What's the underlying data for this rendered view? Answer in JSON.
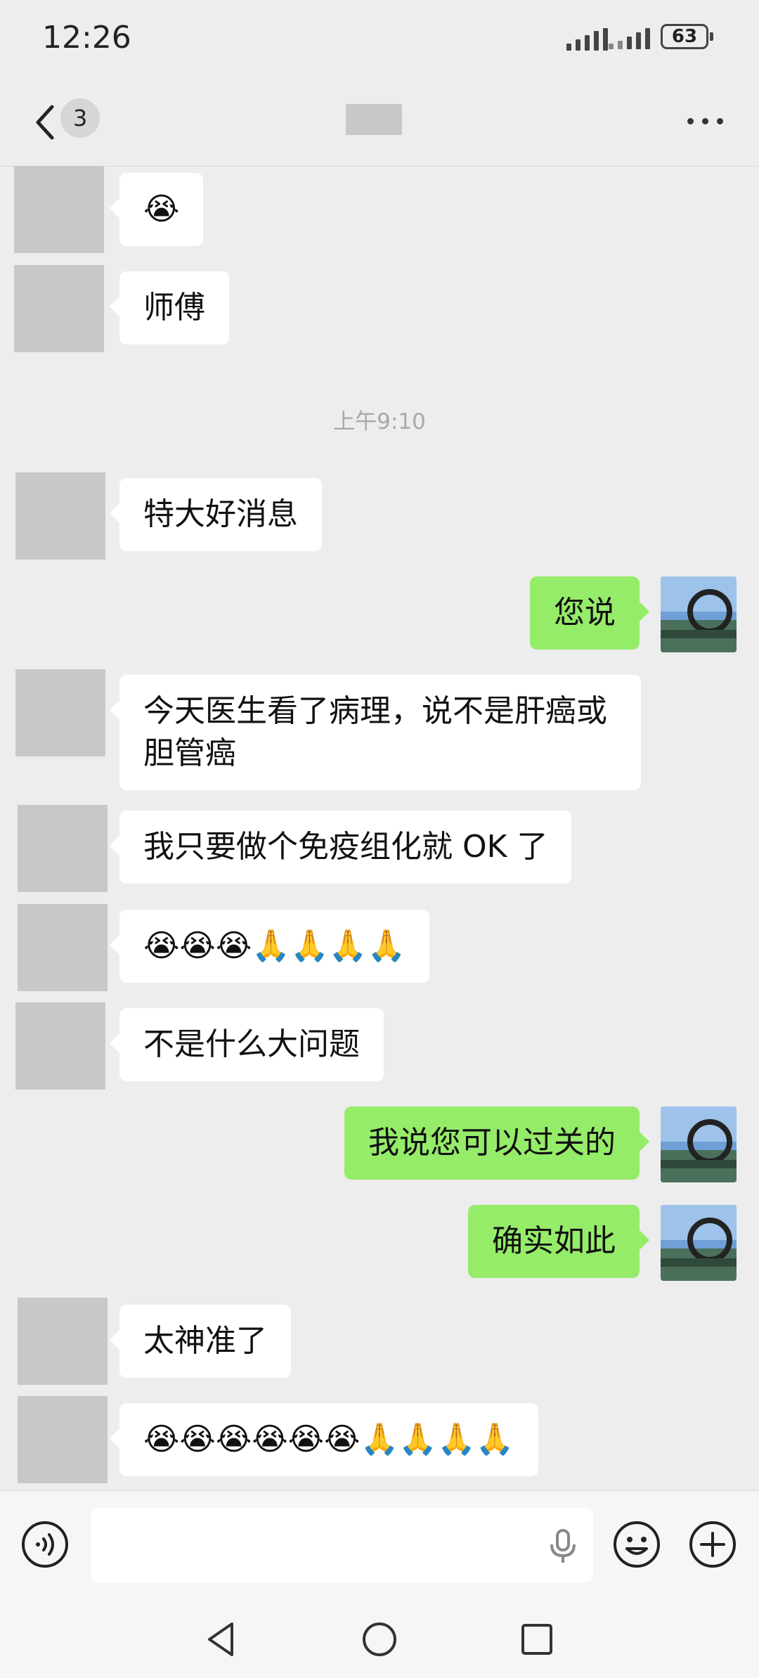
{
  "status_bar": {
    "time": "12:26",
    "battery": "63"
  },
  "header": {
    "unread_count": "3"
  },
  "timestamp": "上午9:10",
  "messages": [
    {
      "side": "in",
      "text": "😭"
    },
    {
      "side": "in",
      "text": "师傅"
    },
    {
      "side": "in",
      "text": "特大好消息"
    },
    {
      "side": "out",
      "text": "您说"
    },
    {
      "side": "in",
      "text": "今天医生看了病理，说不是肝癌或胆管癌"
    },
    {
      "side": "in",
      "text": "我只要做个免疫组化就 OK 了"
    },
    {
      "side": "in",
      "text": "😭😭😭🙏🙏🙏🙏"
    },
    {
      "side": "in",
      "text": "不是什么大问题"
    },
    {
      "side": "out",
      "text": "我说您可以过关的"
    },
    {
      "side": "out",
      "text": "确实如此"
    },
    {
      "side": "in",
      "text": "太神准了"
    },
    {
      "side": "in",
      "text": "😭😭😭😭😭😭🙏🙏🙏🙏"
    }
  ],
  "icons": {
    "back": "chevron-left-icon",
    "more": "more-icon",
    "voice": "voice-input-icon",
    "mic": "microphone-icon",
    "emoji": "emoji-icon",
    "add": "plus-icon",
    "nav_back": "triangle-back-icon",
    "nav_home": "circle-home-icon",
    "nav_recent": "square-recent-icon"
  },
  "colors": {
    "incoming_bubble": "#ffffff",
    "outgoing_bubble": "#95ec69",
    "background": "#ededed"
  }
}
